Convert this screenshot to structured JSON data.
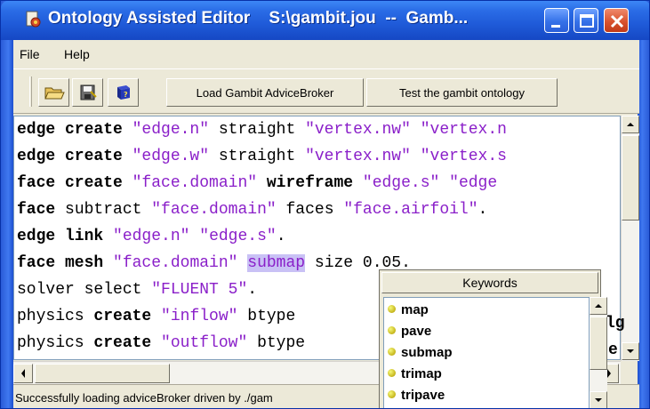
{
  "window": {
    "title": "Ontology Assisted Editor    S:\\gambit.jou  --  Gamb...",
    "app_icon": "gear-document-icon",
    "controls": [
      "minimize-icon",
      "maximize-icon",
      "close-icon"
    ]
  },
  "menu": {
    "items": [
      "File",
      "Help"
    ]
  },
  "toolbar": {
    "icons": [
      "open-folder-icon",
      "save-icon",
      "help-book-icon"
    ],
    "buttons": [
      "Load Gambit AdviceBroker",
      "Test the gambit ontology"
    ]
  },
  "editor": {
    "lines": [
      [
        {
          "t": "edge create ",
          "c": "kw"
        },
        {
          "t": "\"edge.n\"",
          "c": "str"
        },
        {
          "t": " straight ",
          "c": ""
        },
        {
          "t": "\"vertex.nw\"",
          "c": "str"
        },
        {
          "t": " ",
          "c": ""
        },
        {
          "t": "\"vertex.n",
          "c": "str"
        }
      ],
      [
        {
          "t": "edge create ",
          "c": "kw"
        },
        {
          "t": "\"edge.w\"",
          "c": "str"
        },
        {
          "t": " straight ",
          "c": ""
        },
        {
          "t": "\"vertex.nw\"",
          "c": "str"
        },
        {
          "t": " ",
          "c": ""
        },
        {
          "t": "\"vertex.s",
          "c": "str"
        }
      ],
      [
        {
          "t": "face create ",
          "c": "kw"
        },
        {
          "t": "\"face.domain\"",
          "c": "str"
        },
        {
          "t": " ",
          "c": ""
        },
        {
          "t": "wireframe",
          "c": "kw"
        },
        {
          "t": " ",
          "c": ""
        },
        {
          "t": "\"edge.s\"",
          "c": "str"
        },
        {
          "t": " ",
          "c": ""
        },
        {
          "t": "\"edge",
          "c": "str"
        }
      ],
      [
        {
          "t": "face",
          "c": "kw"
        },
        {
          "t": " subtract ",
          "c": ""
        },
        {
          "t": "\"face.domain\"",
          "c": "str"
        },
        {
          "t": " faces ",
          "c": ""
        },
        {
          "t": "\"face.airfoil\"",
          "c": "str"
        },
        {
          "t": ".",
          "c": ""
        }
      ],
      [
        {
          "t": "edge link ",
          "c": "kw"
        },
        {
          "t": "\"edge.n\"",
          "c": "str"
        },
        {
          "t": " ",
          "c": ""
        },
        {
          "t": "\"edge.s\"",
          "c": "str"
        },
        {
          "t": ".",
          "c": ""
        }
      ],
      [
        {
          "t": "face mesh ",
          "c": "kw"
        },
        {
          "t": "\"face.domain\"",
          "c": "str"
        },
        {
          "t": " ",
          "c": ""
        },
        {
          "t": "submap",
          "c": "hl"
        },
        {
          "t": " size 0.05.",
          "c": ""
        }
      ],
      [
        {
          "t": "solver select ",
          "c": ""
        },
        {
          "t": "\"FLUENT 5\"",
          "c": "str"
        },
        {
          "t": ".",
          "c": ""
        }
      ],
      [
        {
          "t": "physics ",
          "c": ""
        },
        {
          "t": "create",
          "c": "kw"
        },
        {
          "t": " ",
          "c": ""
        },
        {
          "t": "\"inflow\"",
          "c": "str"
        },
        {
          "t": " btype",
          "c": ""
        }
      ],
      [
        {
          "t": "physics ",
          "c": ""
        },
        {
          "t": "create",
          "c": "kw"
        },
        {
          "t": " ",
          "c": ""
        },
        {
          "t": "\"outflow\"",
          "c": "str"
        },
        {
          "t": " btype",
          "c": ""
        }
      ]
    ],
    "overflow_fragments": [
      "lg",
      "e"
    ]
  },
  "keywords_popup": {
    "title": "Keywords",
    "items": [
      "map",
      "pave",
      "submap",
      "trimap",
      "tripave"
    ]
  },
  "status": {
    "text": "Successfully loading adviceBroker driven by ./gam"
  },
  "colors": {
    "title_bar": "#2a6ce6",
    "close_button": "#d9532f",
    "string_literal": "#8a1fc9",
    "selection": "#c9c1f5",
    "chrome": "#ece9d8"
  }
}
